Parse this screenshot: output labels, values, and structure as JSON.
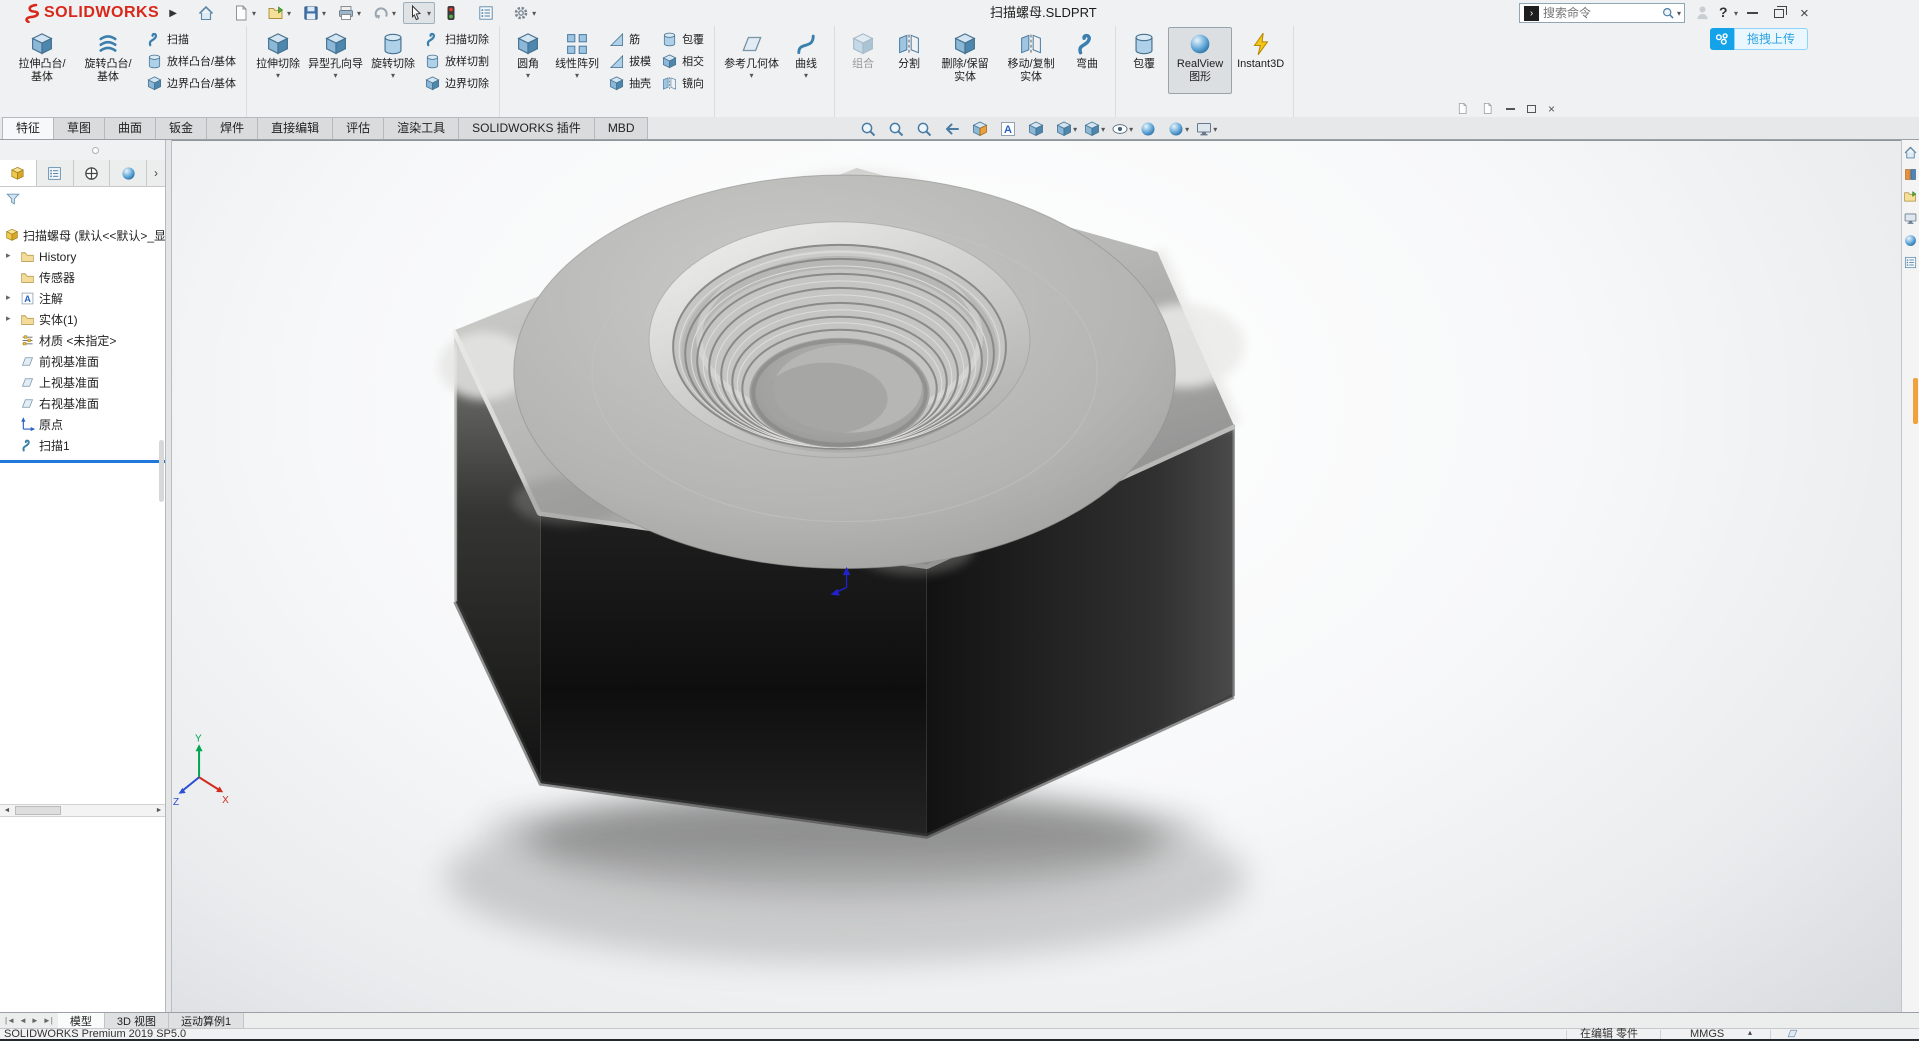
{
  "title_bar": {
    "app_name": "SOLIDWORKS",
    "document_title": "扫描螺母.SLDPRT",
    "search_placeholder": "搜索命令",
    "help_label": "?",
    "upload_label": "拖拽上传"
  },
  "quick_access": [
    {
      "name": "home-button",
      "icon": "home-icon",
      "sym": "#s-home"
    },
    {
      "name": "new-file-button",
      "icon": "new-file-icon",
      "sym": "#s-page",
      "caret": true
    },
    {
      "name": "open-file-button",
      "icon": "open-folder-icon",
      "sym": "#s-open",
      "caret": true
    },
    {
      "name": "save-button",
      "icon": "save-icon",
      "sym": "#s-floppy",
      "caret": true
    },
    {
      "name": "print-button",
      "icon": "print-icon",
      "sym": "#s-print",
      "caret": true
    },
    {
      "name": "undo-button",
      "icon": "undo-icon",
      "sym": "#s-undo",
      "caret": true
    },
    {
      "name": "select-tool-button",
      "icon": "cursor-icon",
      "sym": "#s-cursor",
      "caret": true,
      "active": true
    },
    {
      "name": "rebuild-button",
      "icon": "traffic-light-icon",
      "sym": "#s-traffic"
    },
    {
      "name": "options-button",
      "icon": "options-list-icon",
      "sym": "#s-list"
    },
    {
      "name": "settings-button",
      "icon": "gear-icon",
      "sym": "#s-gear",
      "caret": true
    }
  ],
  "ribbon": {
    "groups": [
      {
        "tall": [
          {
            "name": "extruded-boss-base-button",
            "icon": "extruded-boss-icon",
            "sym": "#s-cube",
            "label": "拉伸凸台/基体"
          },
          {
            "name": "revolved-boss-base-button",
            "icon": "revolved-boss-icon",
            "sym": "#s-spring",
            "label": "旋转凸台/基体"
          }
        ],
        "stack": [
          {
            "name": "sweep-button",
            "icon": "sweep-icon",
            "sym": "#s-swirl",
            "label": "扫描"
          },
          {
            "name": "lofted-boss-base-button",
            "icon": "loft-icon",
            "sym": "#s-cyl",
            "label": "放样凸台/基体"
          },
          {
            "name": "boundary-boss-base-button",
            "icon": "boundary-boss-icon",
            "sym": "#s-cube",
            "label": "边界凸台/基体"
          }
        ]
      },
      {
        "tall": [
          {
            "name": "extruded-cut-button",
            "icon": "extruded-cut-icon",
            "sym": "#s-cube",
            "label": "拉伸切除",
            "caret": true
          },
          {
            "name": "hole-wizard-button",
            "icon": "hole-wizard-icon",
            "sym": "#s-cube",
            "label": "异型孔向导",
            "caret": true
          },
          {
            "name": "revolved-cut-button",
            "icon": "revolved-cut-icon",
            "sym": "#s-cyl",
            "label": "旋转切除",
            "caret": true
          }
        ],
        "stack": [
          {
            "name": "swept-cut-button",
            "icon": "swept-cut-icon",
            "sym": "#s-swirl",
            "label": "扫描切除"
          },
          {
            "name": "lofted-cut-button",
            "icon": "lofted-cut-icon",
            "sym": "#s-cyl",
            "label": "放样切割"
          },
          {
            "name": "boundary-cut-button",
            "icon": "boundary-cut-icon",
            "sym": "#s-cube",
            "label": "边界切除"
          }
        ]
      },
      {
        "tall": [
          {
            "name": "fillet-button",
            "icon": "fillet-icon",
            "sym": "#s-cube",
            "label": "圆角",
            "caret": true
          },
          {
            "name": "linear-pattern-button",
            "icon": "linear-pattern-icon",
            "sym": "#s-pattern",
            "label": "线性阵列",
            "caret": true
          }
        ],
        "stack": [
          {
            "name": "rib-button",
            "icon": "rib-icon",
            "sym": "#s-rib",
            "label": "筋"
          },
          {
            "name": "draft-button",
            "icon": "draft-icon",
            "sym": "#s-rib",
            "label": "拔模"
          },
          {
            "name": "shell-button",
            "icon": "shell-icon",
            "sym": "#s-cube",
            "label": "抽壳"
          }
        ],
        "stack2": [
          {
            "name": "wrap-button",
            "icon": "wrap-icon",
            "sym": "#s-cyl",
            "label": "包覆"
          },
          {
            "name": "intersect-button",
            "icon": "intersect-icon",
            "sym": "#s-cube",
            "label": "相交"
          },
          {
            "name": "mirror-button",
            "icon": "mirror-icon",
            "sym": "#s-mirror",
            "label": "镜向"
          }
        ]
      },
      {
        "tall": [
          {
            "name": "reference-geometry-button",
            "icon": "reference-geometry-icon",
            "sym": "#s-plane",
            "label": "参考几何体",
            "caret": true
          },
          {
            "name": "curves-button",
            "icon": "curves-icon",
            "sym": "#s-curve",
            "label": "曲线",
            "caret": true
          }
        ]
      },
      {
        "tall": [
          {
            "name": "combine-button",
            "icon": "combine-icon",
            "sym": "#s-cube",
            "label": "组合",
            "disabled": true
          },
          {
            "name": "split-button",
            "icon": "split-icon",
            "sym": "#s-mirror",
            "label": "分割"
          },
          {
            "name": "delete-keep-body-button",
            "icon": "delete-keep-body-icon",
            "sym": "#s-cube",
            "label": "删除/保留实体"
          },
          {
            "name": "move-copy-body-button",
            "icon": "move-copy-body-icon",
            "sym": "#s-mirror",
            "label": "移动/复制实体"
          },
          {
            "name": "flex-button",
            "icon": "flex-icon",
            "sym": "#s-swirl",
            "label": "弯曲"
          }
        ]
      },
      {
        "tall": [
          {
            "name": "wrap-button-2",
            "icon": "wrap-icon",
            "sym": "#s-cyl",
            "label": "包覆"
          },
          {
            "name": "realview-graphics-button",
            "icon": "realview-sphere-icon",
            "sym": "#s-sphere",
            "label": "RealView 图形",
            "active": true
          },
          {
            "name": "instant3d-button",
            "icon": "instant3d-icon",
            "sym": "#s-bolt",
            "label": "Instant3D"
          }
        ]
      }
    ]
  },
  "command_tabs": [
    {
      "name": "features-tab",
      "label": "特征",
      "active": true
    },
    {
      "name": "sketch-tab",
      "label": "草图"
    },
    {
      "name": "surfaces-tab",
      "label": "曲面"
    },
    {
      "name": "sheet-metal-tab",
      "label": "钣金"
    },
    {
      "name": "weldments-tab",
      "label": "焊件"
    },
    {
      "name": "direct-editing-tab",
      "label": "直接编辑"
    },
    {
      "name": "evaluate-tab",
      "label": "评估"
    },
    {
      "name": "render-tools-tab",
      "label": "渲染工具"
    },
    {
      "name": "solidworks-addins-tab",
      "label": "SOLIDWORKS 插件"
    },
    {
      "name": "mbd-tab",
      "label": "MBD"
    }
  ],
  "headsup": [
    {
      "name": "zoom-to-fit-button",
      "icon": "zoom-fit-icon",
      "sym": "#s-mag"
    },
    {
      "name": "zoom-to-area-button",
      "icon": "zoom-area-icon",
      "sym": "#s-mag"
    },
    {
      "name": "magnifier-button",
      "icon": "magnifier-icon",
      "sym": "#s-mag"
    },
    {
      "name": "previous-view-button",
      "icon": "previous-view-icon",
      "sym": "#s-arrowl"
    },
    {
      "name": "section-view-button",
      "icon": "section-view-icon",
      "sym": "#s-section"
    },
    {
      "name": "annotation-visibility-button",
      "icon": "annotation-icon",
      "sym": "#s-abox"
    },
    {
      "name": "isometric-view-button",
      "icon": "isometric-cube-icon",
      "sym": "#s-cube"
    },
    {
      "name": "view-orientation-button",
      "icon": "view-orientation-icon",
      "sym": "#s-cube",
      "caret": true
    },
    {
      "name": "display-style-button",
      "icon": "display-style-icon",
      "sym": "#s-cube",
      "caret": true
    },
    {
      "name": "hide-show-items-button",
      "icon": "eye-icon",
      "sym": "#s-eye",
      "caret": true
    },
    {
      "name": "edit-appearance-button",
      "icon": "appearance-sphere-icon",
      "sym": "#s-sphere"
    },
    {
      "name": "apply-scene-button",
      "icon": "scene-sphere-icon",
      "sym": "#s-sphere",
      "caret": true
    },
    {
      "name": "view-settings-button",
      "icon": "monitor-icon",
      "sym": "#s-monitor",
      "caret": true
    }
  ],
  "feature_manager": {
    "tabs": [
      {
        "name": "featuremanager-tab",
        "icon": "feature-tree-icon",
        "sym": "#s-part",
        "active": true
      },
      {
        "name": "propertymanager-tab",
        "icon": "property-manager-icon",
        "sym": "#s-list"
      },
      {
        "name": "configurationmanager-tab",
        "icon": "configurations-icon",
        "sym": "#s-config"
      },
      {
        "name": "displaymanager-tab",
        "icon": "display-manager-icon",
        "sym": "#s-sphere"
      }
    ],
    "root_label": "扫描螺母 (默认<<默认>_显示状",
    "items": [
      {
        "name": "history-item",
        "icon": "history-folder-icon",
        "sym": "#s-folder",
        "label": "History",
        "expand": true
      },
      {
        "name": "sensors-item",
        "icon": "sensors-folder-icon",
        "sym": "#s-folder",
        "label": "传感器"
      },
      {
        "name": "annotations-item",
        "icon": "annotations-icon",
        "sym": "#s-abox",
        "label": "注解",
        "expand": true
      },
      {
        "name": "solid-bodies-item",
        "icon": "solid-bodies-folder-icon",
        "sym": "#s-folder",
        "label": "实体(1)",
        "expand": true
      },
      {
        "name": "material-item",
        "icon": "material-icon",
        "sym": "#s-sliders",
        "label": "材质 <未指定>"
      },
      {
        "name": "front-plane-item",
        "icon": "plane-icon",
        "sym": "#s-plane",
        "label": "前视基准面"
      },
      {
        "name": "top-plane-item",
        "icon": "plane-icon",
        "sym": "#s-plane",
        "label": "上视基准面"
      },
      {
        "name": "right-plane-item",
        "icon": "plane-icon",
        "sym": "#s-plane",
        "label": "右视基准面"
      },
      {
        "name": "origin-item",
        "icon": "origin-icon",
        "sym": "#s-axes",
        "label": "原点"
      },
      {
        "name": "sweep1-item",
        "icon": "sweep-feature-icon",
        "sym": "#s-swirl",
        "label": "扫描1"
      }
    ]
  },
  "viewport": {
    "triad_x": "X",
    "triad_y": "Y",
    "triad_z": "Z"
  },
  "taskpane": [
    {
      "name": "taskpane-home",
      "icon": "home-icon",
      "sym": "#s-home"
    },
    {
      "name": "taskpane-design-library",
      "icon": "design-library-icon",
      "sym": "#s-book"
    },
    {
      "name": "taskpane-file-explorer",
      "icon": "folder-icon",
      "sym": "#s-open"
    },
    {
      "name": "taskpane-view-palette",
      "icon": "view-palette-icon",
      "sym": "#s-monitor"
    },
    {
      "name": "taskpane-appearances",
      "icon": "appearances-icon",
      "sym": "#s-sphere"
    },
    {
      "name": "taskpane-custom-properties",
      "icon": "custom-properties-icon",
      "sym": "#s-list"
    }
  ],
  "bottom_tabs": [
    {
      "name": "model-tab",
      "label": "模型",
      "active": true
    },
    {
      "name": "3d-views-tab",
      "label": "3D 视图"
    },
    {
      "name": "motion-study-tab",
      "label": "运动算例1"
    }
  ],
  "status_bar": {
    "left": "SOLIDWORKS Premium 2019 SP5.0",
    "editing": "在编辑 零件",
    "units": "MMGS"
  },
  "colors": {
    "logo_red": "#d8281a",
    "upload_blue": "#14a3e8",
    "rollback_blue": "#2079d8",
    "taskpane_scroll_orange": "#f0a23c",
    "nut_dark_side": "#1a1a1a",
    "nut_top_gray": "#b6b6b4"
  }
}
